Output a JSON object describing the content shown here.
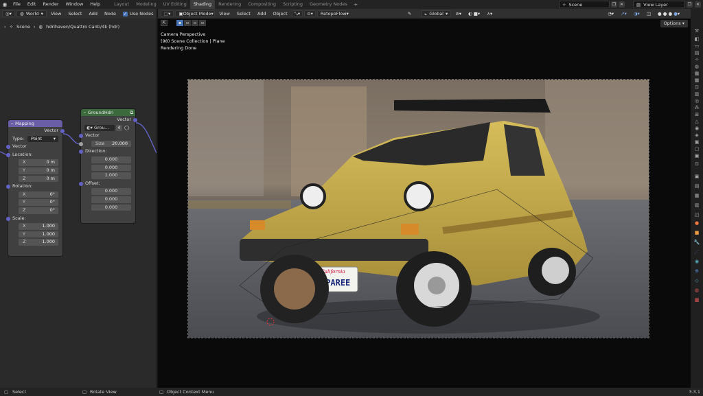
{
  "topbar": {
    "menus": [
      "File",
      "Edit",
      "Render",
      "Window",
      "Help"
    ],
    "workspaces": [
      "Layout",
      "Modeling",
      "UV Editing",
      "Shading",
      "Rendering",
      "Compositing",
      "Scripting",
      "Geometry Nodes"
    ],
    "active_workspace": "Shading",
    "scene": "Scene",
    "view_layer": "View Layer"
  },
  "node_editor": {
    "header": {
      "editor_type_icon": "node-editor-icon",
      "world_select": "World",
      "menus": [
        "View",
        "Select",
        "Add",
        "Node"
      ],
      "use_nodes_label": "Use Nodes",
      "use_nodes_checked": true
    },
    "breadcrumb": {
      "scene": "Scene",
      "path": "hdrihaven/Quattro Canti/4k (hdr)"
    },
    "mapping_node": {
      "title": "Mapping",
      "output": "Vector",
      "type_label": "Type:",
      "type_value": "Point",
      "vector_input": "Vector",
      "location_label": "Location:",
      "location": [
        {
          "axis": "X",
          "value": "0 m"
        },
        {
          "axis": "Y",
          "value": "0 m"
        },
        {
          "axis": "Z",
          "value": "0 m"
        }
      ],
      "rotation_label": "Rotation:",
      "rotation": [
        {
          "axis": "X",
          "value": "0°"
        },
        {
          "axis": "Y",
          "value": "0°"
        },
        {
          "axis": "Z",
          "value": "0°"
        }
      ],
      "scale_label": "Scale:",
      "scale": [
        {
          "axis": "X",
          "value": "1.000"
        },
        {
          "axis": "Y",
          "value": "1.000"
        },
        {
          "axis": "Z",
          "value": "1.000"
        }
      ]
    },
    "groundhdri_node": {
      "title": "GroundHdri",
      "output": "Vector",
      "group_name": "Grou...",
      "group_users": "4",
      "vector_input": "Vector",
      "size_label": "Size",
      "size_value": "20.000",
      "direction_label": "Direction:",
      "direction": [
        "0.000",
        "0.000",
        "1.000"
      ],
      "offset_label": "Offset:",
      "offset": [
        "0.000",
        "0.000",
        "0.000"
      ]
    }
  },
  "viewport": {
    "header": {
      "mode": "Object Mode",
      "menus": [
        "View",
        "Select",
        "Add",
        "Object"
      ],
      "addon_menu": "RetopoFlow",
      "transform_orientation": "Global"
    },
    "overlay_text": [
      "Camera Perspective",
      "(98) Scene Collection | Plane",
      "Rendering Done"
    ],
    "options_label": "Options",
    "render": {
      "license_plate": "AHPAREE",
      "plate_state": "California"
    }
  },
  "status_bar": {
    "left": "Select",
    "middle": "Rotate View",
    "right": "Object Context Menu",
    "version": "3.3.1"
  },
  "colors": {
    "mapping_header": "#6a5fa6",
    "group_header": "#3b6b3d",
    "vector_socket": "#6363c7",
    "accent": "#4772b3",
    "car_yellow": "#c8ae4a"
  }
}
